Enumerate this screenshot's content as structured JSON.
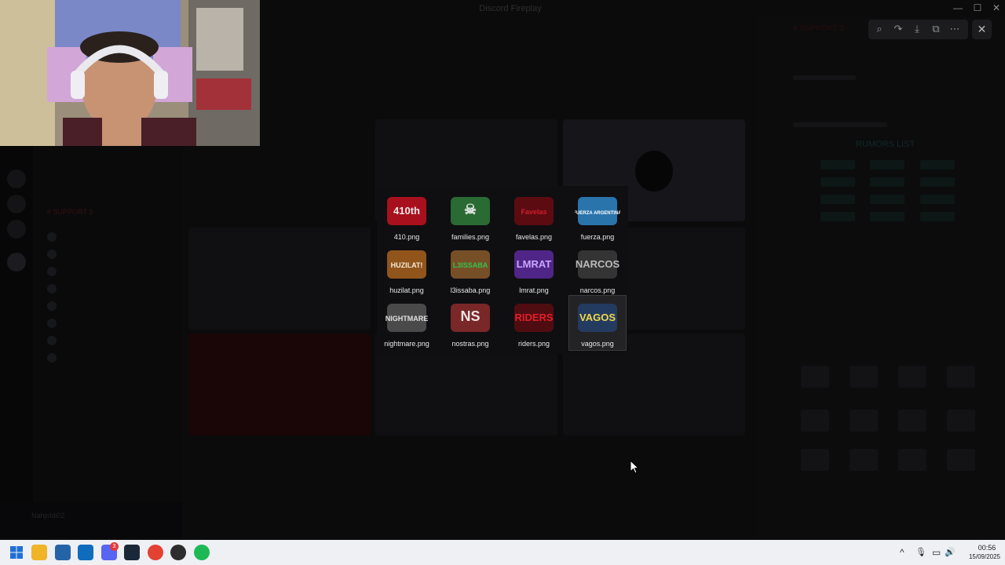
{
  "window": {
    "title": "Discord Fireplay"
  },
  "window_controls": {
    "minimize": "—",
    "maximize": "☐",
    "close": "✕"
  },
  "viewer": {
    "zoom_icon": "zoom-icon",
    "forward_icon": "forward-icon",
    "download_icon": "download-icon",
    "open_external_icon": "open-external-icon",
    "more_icon": "more-icon",
    "close_icon": "close-icon",
    "glyphs": {
      "zoom": "⌕",
      "forward": "↷",
      "download": "⤓",
      "open": "⧉",
      "more": "⋯",
      "close": "✕"
    }
  },
  "sidebar": {
    "header": "# SUPPORT 3",
    "user_name": "Nahjoldi02"
  },
  "right_panel": {
    "channel_title": "# SUPPORT 3",
    "list_title": "RUMORS LIST"
  },
  "file_grid": {
    "files": [
      {
        "name": "410.png",
        "thumb_text": "410th",
        "color": "#e8e8ea",
        "accent": "#c41020"
      },
      {
        "name": "families.png",
        "thumb_text": "☠",
        "color": "#dfe4e0",
        "accent": "#2f7a3a"
      },
      {
        "name": "favelas.png",
        "thumb_text": "Favelas",
        "color": "#d21c2b",
        "accent": "#6a0a12"
      },
      {
        "name": "fuerza.png",
        "thumb_text": "FUERZA ARGENTINA",
        "color": "#ffffff",
        "accent": "#2f86c8"
      },
      {
        "name": "huzilat.png",
        "thumb_text": "HUZILAT!",
        "color": "#f4e9d6",
        "accent": "#a8611f"
      },
      {
        "name": "l3issaba.png",
        "thumb_text": "L3ISSABA",
        "color": "#35c24c",
        "accent": "#8a5a2b"
      },
      {
        "name": "lmrat.png",
        "thumb_text": "LMRAT",
        "color": "#c9a7ff",
        "accent": "#5b2a9c"
      },
      {
        "name": "narcos.png",
        "thumb_text": "NARCOS",
        "color": "#b9b9b9",
        "accent": "#3b3b3b"
      },
      {
        "name": "nightmare.png",
        "thumb_text": "NIGHTMARE",
        "color": "#e1e1e1",
        "accent": "#555555"
      },
      {
        "name": "nostras.png",
        "thumb_text": "NS",
        "color": "#f1e3e3",
        "accent": "#8c2b2b"
      },
      {
        "name": "riders.png",
        "thumb_text": "RIDERS",
        "color": "#e21f2c",
        "accent": "#5a0d12"
      },
      {
        "name": "vagos.png",
        "thumb_text": "VAGOS",
        "color": "#f2d84a",
        "accent": "#24406b"
      }
    ],
    "selected": "vagos.png"
  },
  "taskbar": {
    "apps": [
      {
        "name": "windows-start-icon",
        "color": "#1f6fd6"
      },
      {
        "name": "file-explorer-icon",
        "color": "#f0b429"
      },
      {
        "name": "store-icon",
        "color": "#2563a8"
      },
      {
        "name": "outlook-icon",
        "color": "#0f6cbd"
      },
      {
        "name": "discord-icon",
        "color": "#5865f2"
      },
      {
        "name": "steam-icon",
        "color": "#1b2838"
      },
      {
        "name": "chrome-icon",
        "color": "#e34133"
      },
      {
        "name": "obs-icon",
        "color": "#2d2d2d"
      },
      {
        "name": "spotify-icon",
        "color": "#1db954"
      }
    ],
    "discord_badge": "3",
    "tray": {
      "chevron": "^",
      "mic": "🎙",
      "network": "▭",
      "volume": "🔊"
    },
    "clock": {
      "time": "00:56",
      "date": "15/09/2025"
    }
  }
}
